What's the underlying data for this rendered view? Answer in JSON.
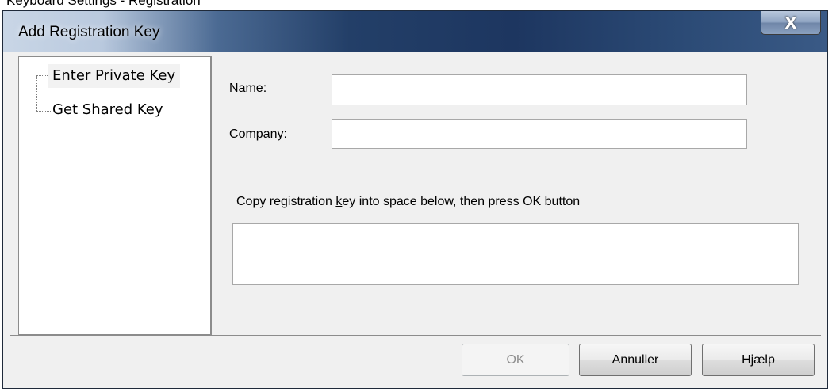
{
  "background_text": "Keyboard Settings - Registration",
  "window": {
    "title": "Add Registration Key",
    "close_glyph": "X"
  },
  "tree": {
    "items": [
      {
        "label": "Enter Private Key",
        "selected": true
      },
      {
        "label": "Get Shared Key",
        "selected": false
      }
    ]
  },
  "form": {
    "name_label_accel": "N",
    "name_label_rest": "ame:",
    "name_value": "",
    "company_label_accel": "C",
    "company_label_rest": "ompany:",
    "company_value": "",
    "instruction_pre": "Copy registration ",
    "instruction_accel": "k",
    "instruction_post": "ey into space below, then press OK button",
    "key_value": ""
  },
  "buttons": {
    "ok_label": "OK",
    "ok_enabled": false,
    "cancel_label": "Annuller",
    "help_label": "Hjælp"
  },
  "colors": {
    "title_gradient_dark": "#1d3660",
    "title_gradient_light": "#c9d6e6",
    "dialog_bg": "#f0f0f0",
    "disabled_text": "#8d8d8d"
  }
}
